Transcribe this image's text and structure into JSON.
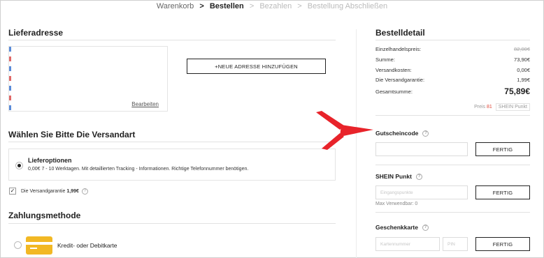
{
  "breadcrumb": {
    "step1": "Warenkorb",
    "step2": "Bestellen",
    "step3": "Bezahlen",
    "step4": "Bestellung Abschließen",
    "sep": ">"
  },
  "delivery": {
    "title": "Lieferadresse",
    "edit_label": "Bearbeiten",
    "add_address_label": "+NEUE ADRESSE HINZUFÜGEN"
  },
  "shipping": {
    "title": "Wählen Sie Bitte Die Versandart",
    "option_title": "Lieferoptionen",
    "option_desc": "0,00€   7 - 10 Werktagen. Mit detaillierten Tracking - Informationen. Richtige Telefonnummer benötigen.",
    "guarantee_label": "Die Versandgarantie",
    "guarantee_price": "1,99€"
  },
  "payment": {
    "title": "Zahlungsmethode",
    "card_label": "Kredit- oder Debitkarte"
  },
  "order": {
    "title": "Bestelldetail",
    "rows": [
      {
        "label": "Einzelhandelspreis:",
        "value": "82,00€"
      },
      {
        "label": "Summe:",
        "value": "73,90€"
      },
      {
        "label": "Versandkosten:",
        "value": "0,00€"
      },
      {
        "label": "Die Versandgarantie:",
        "value": "1,99€"
      }
    ],
    "total_label": "Gesamtsumme:",
    "total_value": "75,89€",
    "points_prefix": "Preis",
    "points_value": "81",
    "points_tag": "SHEIN Punkt"
  },
  "coupon": {
    "label": "Gutscheincode",
    "placeholder": "",
    "button": "FERTIG"
  },
  "points": {
    "label": "SHEIN Punkt",
    "placeholder": "Eingangspunkte",
    "button": "FERTIG",
    "max_note": "Max Verwendbar: 0"
  },
  "giftcard": {
    "label": "Geschenkkarte",
    "card_placeholder": "Kartennummer",
    "pin_placeholder": "PIN",
    "button": "FERTIG"
  },
  "colors": {
    "arrow": "#e8232a",
    "points_highlight": "#e0483a",
    "card_icon": "#f2b824"
  },
  "icons": {
    "help": "?",
    "check": "✓"
  }
}
